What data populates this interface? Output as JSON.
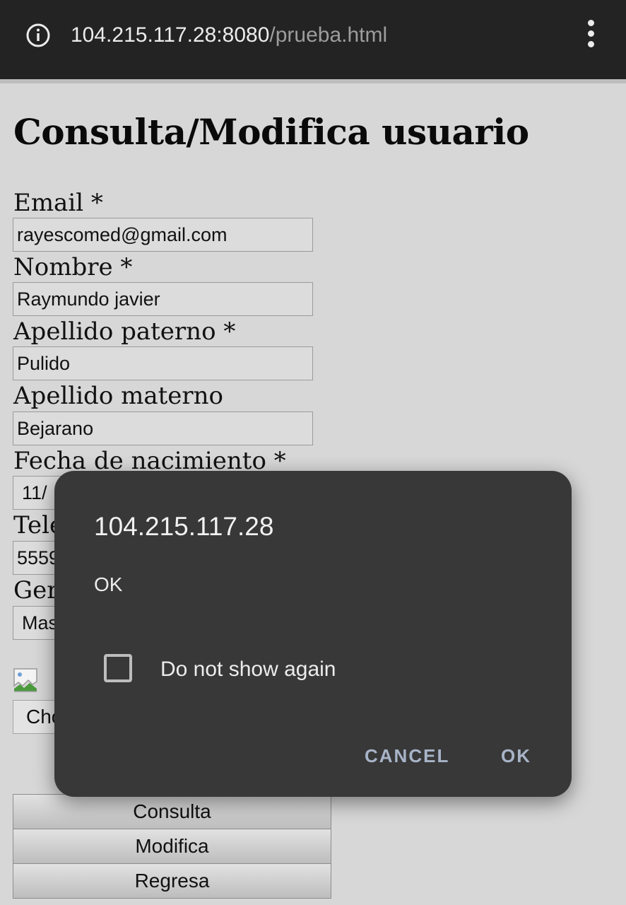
{
  "browser": {
    "url_host": "104.215.117.28:8080",
    "url_path": "/prueba.html",
    "info_icon": "info-circle-icon",
    "menu_icon": "kebab-menu-icon"
  },
  "page": {
    "title": "Consulta/Modifica usuario",
    "fields": [
      {
        "label": "Email *",
        "value": "rayescomed@gmail.com"
      },
      {
        "label": "Nombre *",
        "value": "Raymundo javier"
      },
      {
        "label": "Apellido paterno *",
        "value": "Pulido"
      },
      {
        "label": "Apellido materno",
        "value": "Bejarano"
      },
      {
        "label": "Fecha de nacimiento *",
        "value": "11/"
      },
      {
        "label": "Tele",
        "value": "5559"
      },
      {
        "label": "Ger",
        "value": "Mas"
      }
    ],
    "broken_image_icon": "broken-image-icon",
    "file_button_label": "Cho",
    "buttons": {
      "consulta": "Consulta",
      "modifica": "Modifica",
      "regresa": "Regresa"
    }
  },
  "dialog": {
    "title": "104.215.117.28",
    "message": "OK",
    "checkbox_label": "Do not show again",
    "checkbox_checked": false,
    "cancel_label": "CANCEL",
    "ok_label": "OK",
    "accent_color": "#a8b4c8"
  }
}
